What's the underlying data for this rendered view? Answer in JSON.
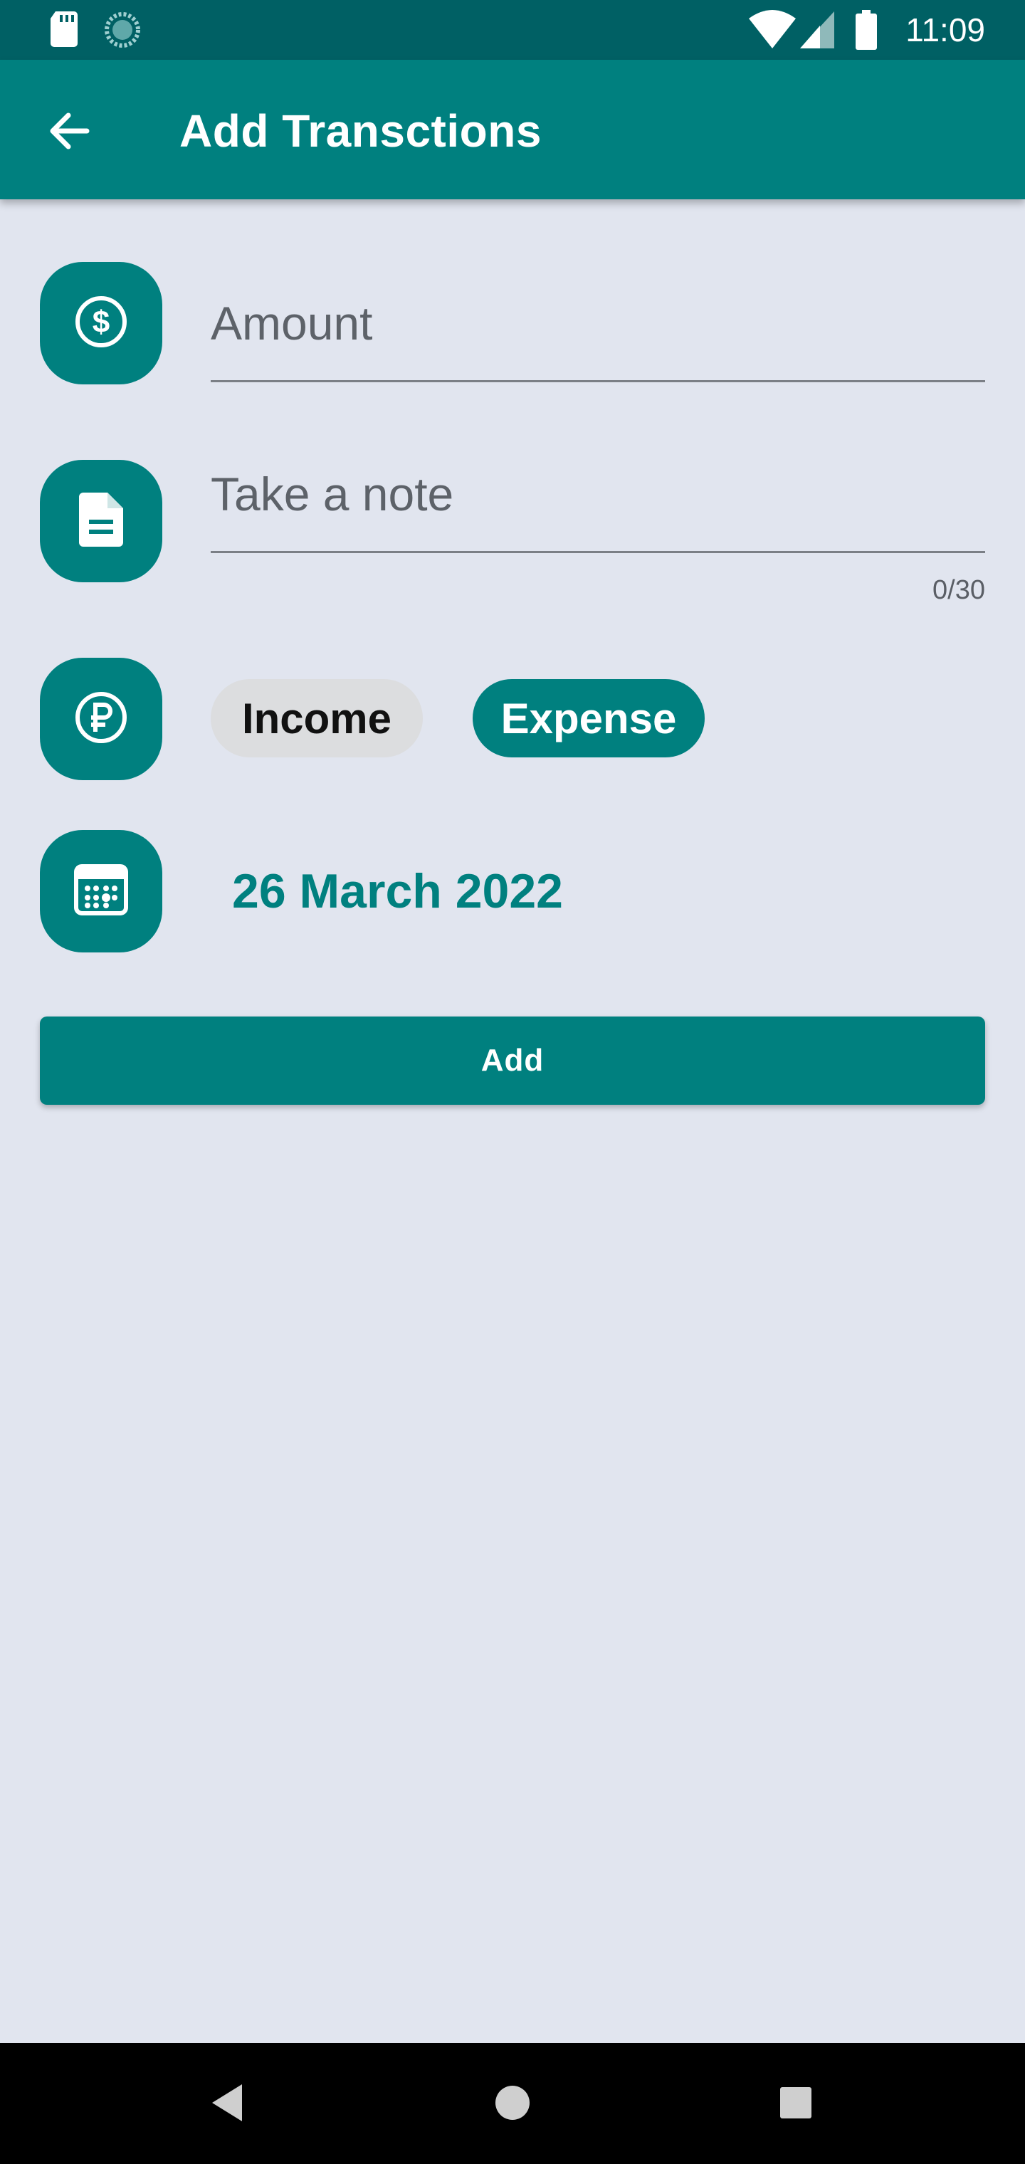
{
  "status_bar": {
    "time": "11:09",
    "icons": [
      "sd-card-icon",
      "loading-icon",
      "wifi-icon",
      "cell-signal-icon",
      "battery-icon"
    ]
  },
  "app_bar": {
    "title": "Add Transctions",
    "back_icon": "arrow-back-icon"
  },
  "form": {
    "amount": {
      "placeholder": "Amount",
      "value": "",
      "icon": "dollar-circle-icon"
    },
    "note": {
      "placeholder": "Take a note",
      "value": "",
      "counter": "0/30",
      "icon": "document-icon"
    },
    "type": {
      "icon": "ruble-circle-icon",
      "options": [
        "Income",
        "Expense"
      ],
      "selected": "Expense"
    },
    "date": {
      "label": "26 March 2022",
      "icon": "calendar-icon"
    },
    "submit_label": "Add"
  },
  "nav_bar": {
    "icons": [
      "back-triangle-icon",
      "home-circle-icon",
      "recents-square-icon"
    ]
  },
  "colors": {
    "primary": "#00807f",
    "status_bar": "#006064",
    "background": "#e1e5ef",
    "chip_unselected": "#dcdddf"
  }
}
